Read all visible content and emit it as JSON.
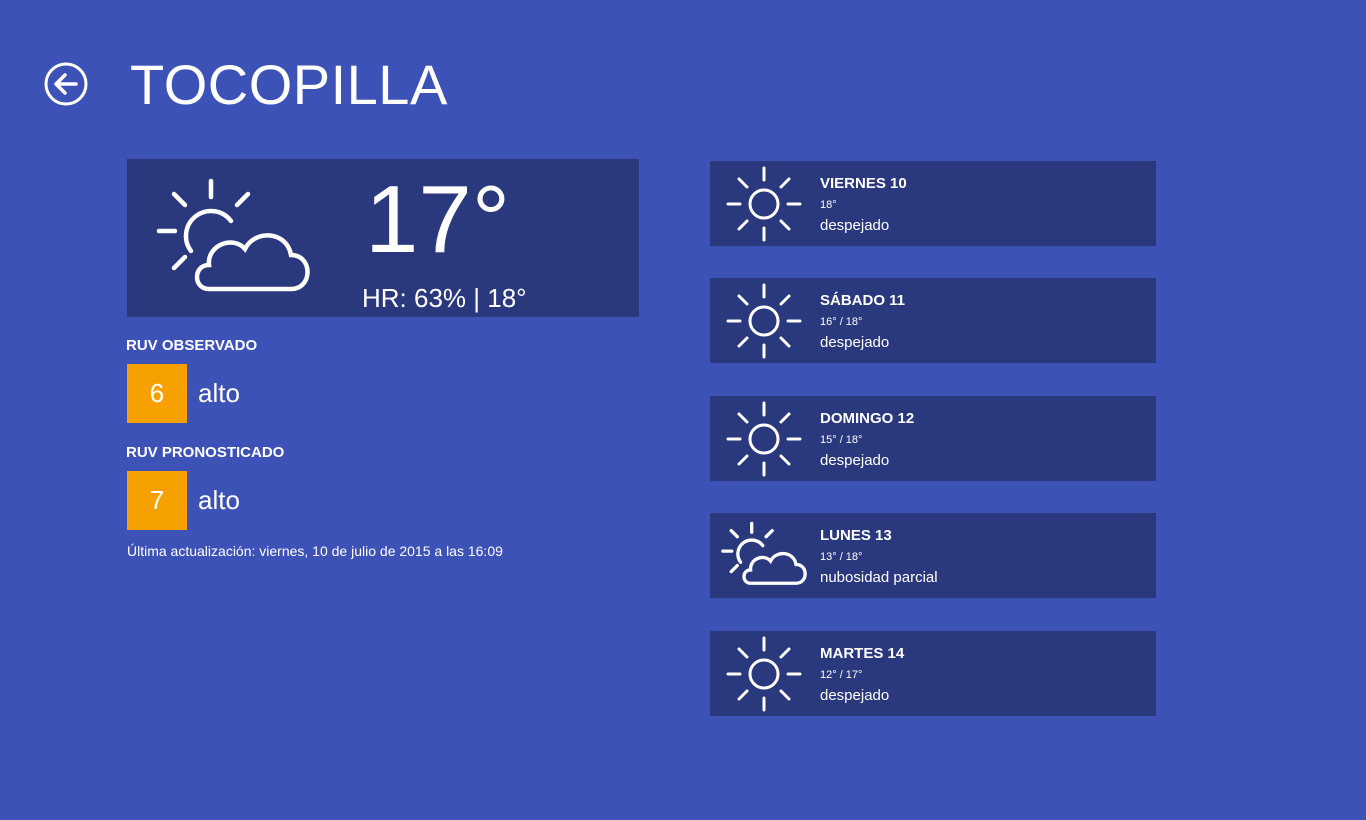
{
  "header": {
    "back_icon": "back-arrow-icon",
    "city": "TOCOPILLA"
  },
  "current": {
    "icon": "partly-cloudy-icon",
    "temperature": "17°",
    "humidity_line": "HR: 63% | 18°"
  },
  "uv_observed": {
    "label": "RUV OBSERVADO",
    "value": "6",
    "level": "alto",
    "color": "#f7a100"
  },
  "uv_forecast": {
    "label": "RUV PRONOSTICADO",
    "value": "7",
    "level": "alto",
    "color": "#f7a100"
  },
  "last_update": "Última actualización: viernes, 10 de julio de 2015 a las 16:09",
  "forecast": [
    {
      "day": "VIERNES 10",
      "range": "18°",
      "desc": "despejado",
      "icon": "sun-icon"
    },
    {
      "day": "SÁBADO 11",
      "range": "16° / 18°",
      "desc": "despejado",
      "icon": "sun-icon"
    },
    {
      "day": "DOMINGO 12",
      "range": "15° / 18°",
      "desc": "despejado",
      "icon": "sun-icon"
    },
    {
      "day": "LUNES 13",
      "range": "13° / 18°",
      "desc": "nubosidad parcial",
      "icon": "partly-cloudy-icon"
    },
    {
      "day": "MARTES 14",
      "range": "12° / 17°",
      "desc": "despejado",
      "icon": "sun-icon"
    }
  ],
  "colors": {
    "background": "#3d52b6",
    "card": "#2a387e",
    "uv_accent": "#f7a100"
  }
}
